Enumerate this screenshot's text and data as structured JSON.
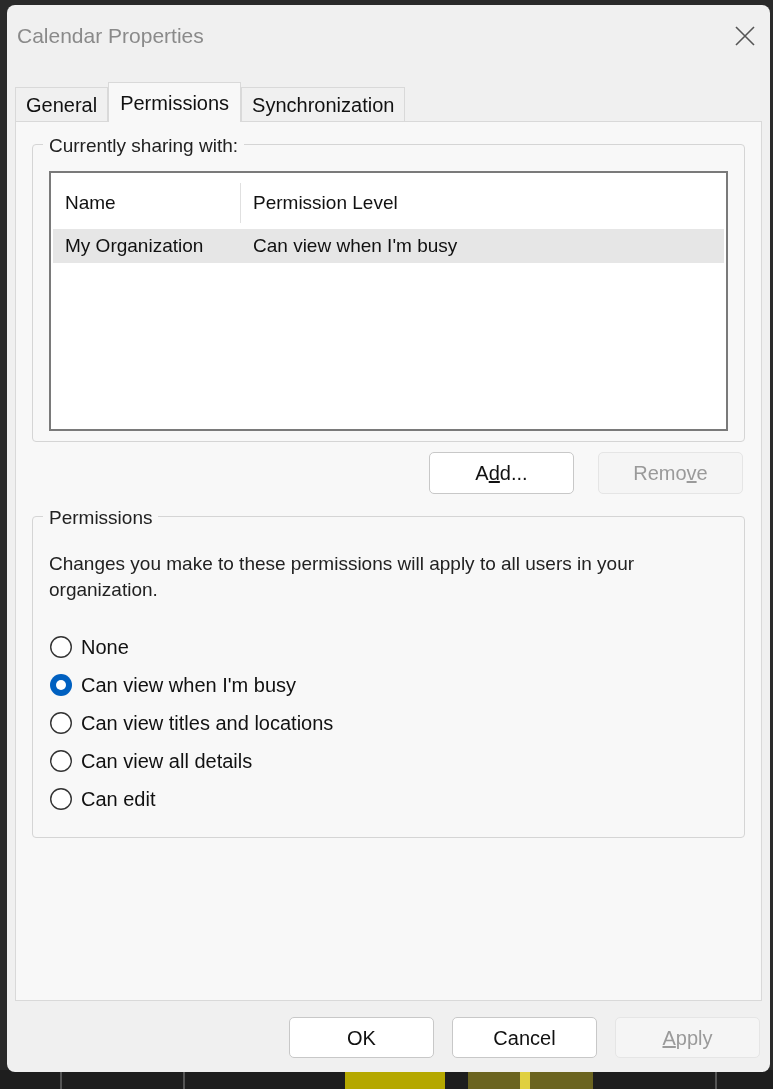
{
  "window": {
    "title": "Calendar Properties"
  },
  "tabs": [
    {
      "label": "General",
      "selected": false
    },
    {
      "label": "Permissions",
      "selected": true
    },
    {
      "label": "Synchronization",
      "selected": false
    }
  ],
  "sharing": {
    "title": "Currently sharing with:",
    "columns": [
      "Name",
      "Permission Level"
    ],
    "rows": [
      {
        "cells": [
          "My Organization",
          "Can view when I'm busy"
        ],
        "selected": true
      }
    ],
    "buttons": [
      {
        "label": "A",
        "access_key": "d",
        "label_end": "d...",
        "disabled": false
      },
      {
        "label": "Remo",
        "access_key": "v",
        "label_end": "e",
        "disabled": true
      }
    ]
  },
  "permissions": {
    "title": "Permissions",
    "note": "Changes you make to these permissions will apply to all users in your organization.",
    "options": [
      {
        "label": "None",
        "selected": false
      },
      {
        "label": "Can view when I'm busy",
        "selected": true
      },
      {
        "label": "Can view titles and locations",
        "selected": false
      },
      {
        "label": "Can view all details",
        "selected": false
      },
      {
        "label": "Can edit",
        "selected": false
      }
    ]
  },
  "buttons": [
    {
      "label": "OK",
      "disabled": false
    },
    {
      "label": "Cancel",
      "disabled": false
    },
    {
      "access_key": "A",
      "label_end": "pply",
      "disabled": true
    }
  ]
}
